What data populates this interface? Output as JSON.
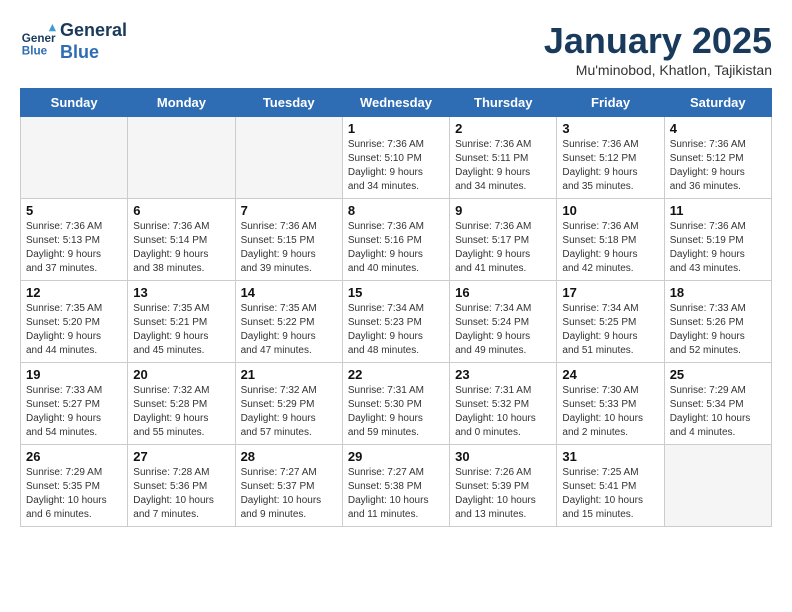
{
  "header": {
    "logo_line1": "General",
    "logo_line2": "Blue",
    "month": "January 2025",
    "location": "Mu'minobod, Khatlon, Tajikistan"
  },
  "days_of_week": [
    "Sunday",
    "Monday",
    "Tuesday",
    "Wednesday",
    "Thursday",
    "Friday",
    "Saturday"
  ],
  "weeks": [
    [
      {
        "day": "",
        "info": ""
      },
      {
        "day": "",
        "info": ""
      },
      {
        "day": "",
        "info": ""
      },
      {
        "day": "1",
        "info": "Sunrise: 7:36 AM\nSunset: 5:10 PM\nDaylight: 9 hours\nand 34 minutes."
      },
      {
        "day": "2",
        "info": "Sunrise: 7:36 AM\nSunset: 5:11 PM\nDaylight: 9 hours\nand 34 minutes."
      },
      {
        "day": "3",
        "info": "Sunrise: 7:36 AM\nSunset: 5:12 PM\nDaylight: 9 hours\nand 35 minutes."
      },
      {
        "day": "4",
        "info": "Sunrise: 7:36 AM\nSunset: 5:12 PM\nDaylight: 9 hours\nand 36 minutes."
      }
    ],
    [
      {
        "day": "5",
        "info": "Sunrise: 7:36 AM\nSunset: 5:13 PM\nDaylight: 9 hours\nand 37 minutes."
      },
      {
        "day": "6",
        "info": "Sunrise: 7:36 AM\nSunset: 5:14 PM\nDaylight: 9 hours\nand 38 minutes."
      },
      {
        "day": "7",
        "info": "Sunrise: 7:36 AM\nSunset: 5:15 PM\nDaylight: 9 hours\nand 39 minutes."
      },
      {
        "day": "8",
        "info": "Sunrise: 7:36 AM\nSunset: 5:16 PM\nDaylight: 9 hours\nand 40 minutes."
      },
      {
        "day": "9",
        "info": "Sunrise: 7:36 AM\nSunset: 5:17 PM\nDaylight: 9 hours\nand 41 minutes."
      },
      {
        "day": "10",
        "info": "Sunrise: 7:36 AM\nSunset: 5:18 PM\nDaylight: 9 hours\nand 42 minutes."
      },
      {
        "day": "11",
        "info": "Sunrise: 7:36 AM\nSunset: 5:19 PM\nDaylight: 9 hours\nand 43 minutes."
      }
    ],
    [
      {
        "day": "12",
        "info": "Sunrise: 7:35 AM\nSunset: 5:20 PM\nDaylight: 9 hours\nand 44 minutes."
      },
      {
        "day": "13",
        "info": "Sunrise: 7:35 AM\nSunset: 5:21 PM\nDaylight: 9 hours\nand 45 minutes."
      },
      {
        "day": "14",
        "info": "Sunrise: 7:35 AM\nSunset: 5:22 PM\nDaylight: 9 hours\nand 47 minutes."
      },
      {
        "day": "15",
        "info": "Sunrise: 7:34 AM\nSunset: 5:23 PM\nDaylight: 9 hours\nand 48 minutes."
      },
      {
        "day": "16",
        "info": "Sunrise: 7:34 AM\nSunset: 5:24 PM\nDaylight: 9 hours\nand 49 minutes."
      },
      {
        "day": "17",
        "info": "Sunrise: 7:34 AM\nSunset: 5:25 PM\nDaylight: 9 hours\nand 51 minutes."
      },
      {
        "day": "18",
        "info": "Sunrise: 7:33 AM\nSunset: 5:26 PM\nDaylight: 9 hours\nand 52 minutes."
      }
    ],
    [
      {
        "day": "19",
        "info": "Sunrise: 7:33 AM\nSunset: 5:27 PM\nDaylight: 9 hours\nand 54 minutes."
      },
      {
        "day": "20",
        "info": "Sunrise: 7:32 AM\nSunset: 5:28 PM\nDaylight: 9 hours\nand 55 minutes."
      },
      {
        "day": "21",
        "info": "Sunrise: 7:32 AM\nSunset: 5:29 PM\nDaylight: 9 hours\nand 57 minutes."
      },
      {
        "day": "22",
        "info": "Sunrise: 7:31 AM\nSunset: 5:30 PM\nDaylight: 9 hours\nand 59 minutes."
      },
      {
        "day": "23",
        "info": "Sunrise: 7:31 AM\nSunset: 5:32 PM\nDaylight: 10 hours\nand 0 minutes."
      },
      {
        "day": "24",
        "info": "Sunrise: 7:30 AM\nSunset: 5:33 PM\nDaylight: 10 hours\nand 2 minutes."
      },
      {
        "day": "25",
        "info": "Sunrise: 7:29 AM\nSunset: 5:34 PM\nDaylight: 10 hours\nand 4 minutes."
      }
    ],
    [
      {
        "day": "26",
        "info": "Sunrise: 7:29 AM\nSunset: 5:35 PM\nDaylight: 10 hours\nand 6 minutes."
      },
      {
        "day": "27",
        "info": "Sunrise: 7:28 AM\nSunset: 5:36 PM\nDaylight: 10 hours\nand 7 minutes."
      },
      {
        "day": "28",
        "info": "Sunrise: 7:27 AM\nSunset: 5:37 PM\nDaylight: 10 hours\nand 9 minutes."
      },
      {
        "day": "29",
        "info": "Sunrise: 7:27 AM\nSunset: 5:38 PM\nDaylight: 10 hours\nand 11 minutes."
      },
      {
        "day": "30",
        "info": "Sunrise: 7:26 AM\nSunset: 5:39 PM\nDaylight: 10 hours\nand 13 minutes."
      },
      {
        "day": "31",
        "info": "Sunrise: 7:25 AM\nSunset: 5:41 PM\nDaylight: 10 hours\nand 15 minutes."
      },
      {
        "day": "",
        "info": ""
      }
    ]
  ]
}
